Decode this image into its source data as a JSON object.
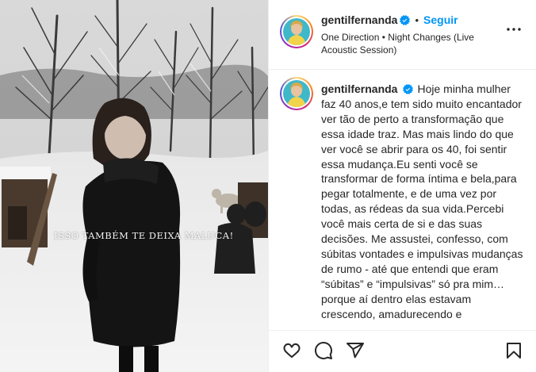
{
  "post": {
    "username": "gentilfernanda",
    "follow_label": "Seguir",
    "separator": "•",
    "song": "One Direction • Night Changes (Live Acoustic Session)",
    "caption": "Hoje minha mulher faz 40 anos,e tem sido muito encantador ver tão de perto a transformação que essa idade traz. Mas mais lindo do que ver você se abrir para os 40, foi sentir essa mudança.Eu senti você se transformar de forma íntima e bela,para pegar totalmente, e de uma vez por todas, as rédeas da sua vida.Percebi você mais certa de si e das suas decisões. Me assustei, confesso, com súbitas vontades e impulsivas mudanças de rumo - até que entendi que eram “súbitas” e “impulsivas” só pra mim… porque aí dentro elas estavam crescendo, amadurecendo e"
  },
  "media": {
    "overlay_text": "ISSO TAMBÉM TE DEIXA MALUCA!"
  },
  "icons": {
    "verified": "verified-badge-icon",
    "more": "more-options-icon",
    "like": "heart-icon",
    "comment": "comment-icon",
    "share": "share-icon",
    "save": "bookmark-icon"
  },
  "colors": {
    "accent": "#0095f6",
    "text": "#262626",
    "divider": "#efefef"
  }
}
